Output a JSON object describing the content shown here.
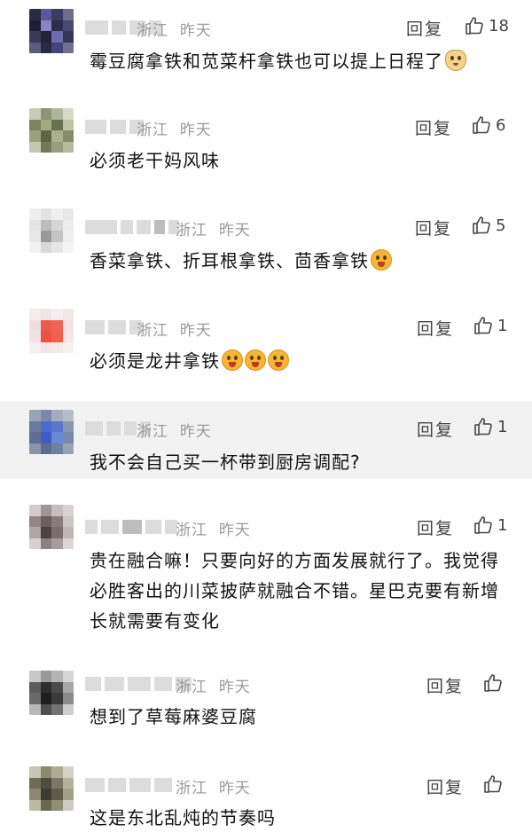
{
  "reply_label": "回复",
  "comments": [
    {
      "location": "浙江",
      "time": "昨天",
      "likes": "18",
      "text": "霉豆腐拿铁和苋菜杆拿铁也可以提上日程了",
      "emoji": [
        "doge-icon"
      ]
    },
    {
      "location": "浙江",
      "time": "昨天",
      "likes": "6",
      "text": "必须老干妈风味",
      "emoji": []
    },
    {
      "location": "浙江",
      "time": "昨天",
      "likes": "5",
      "text": "香菜拿铁、折耳根拿铁、茴香拿铁",
      "emoji": [
        "yummy-face-icon"
      ]
    },
    {
      "location": "浙江",
      "time": "昨天",
      "likes": "1",
      "text": "必须是龙井拿铁",
      "emoji": [
        "shocked-face-icon",
        "shocked-face-icon",
        "shocked-face-icon"
      ]
    },
    {
      "location": "浙江",
      "time": "昨天",
      "likes": "1",
      "text": "我不会自己买一杯带到厨房调配?",
      "emoji": []
    },
    {
      "location": "浙江",
      "time": "昨天",
      "likes": "1",
      "text": "贵在融合嘛！只要向好的方面发展就行了。我觉得必胜客出的川菜披萨就融合不错。星巴克要有新增长就需要有变化",
      "emoji": []
    },
    {
      "location": "浙江",
      "time": "昨天",
      "likes": "",
      "text": "想到了草莓麻婆豆腐",
      "emoji": []
    },
    {
      "location": "浙江",
      "time": "昨天",
      "likes": "",
      "text": "这是东北乱炖的节奏吗",
      "emoji": []
    }
  ],
  "colors": {
    "text": "#111111",
    "meta": "#9a9a9a",
    "highlight_bg": "#f2f2f2"
  }
}
